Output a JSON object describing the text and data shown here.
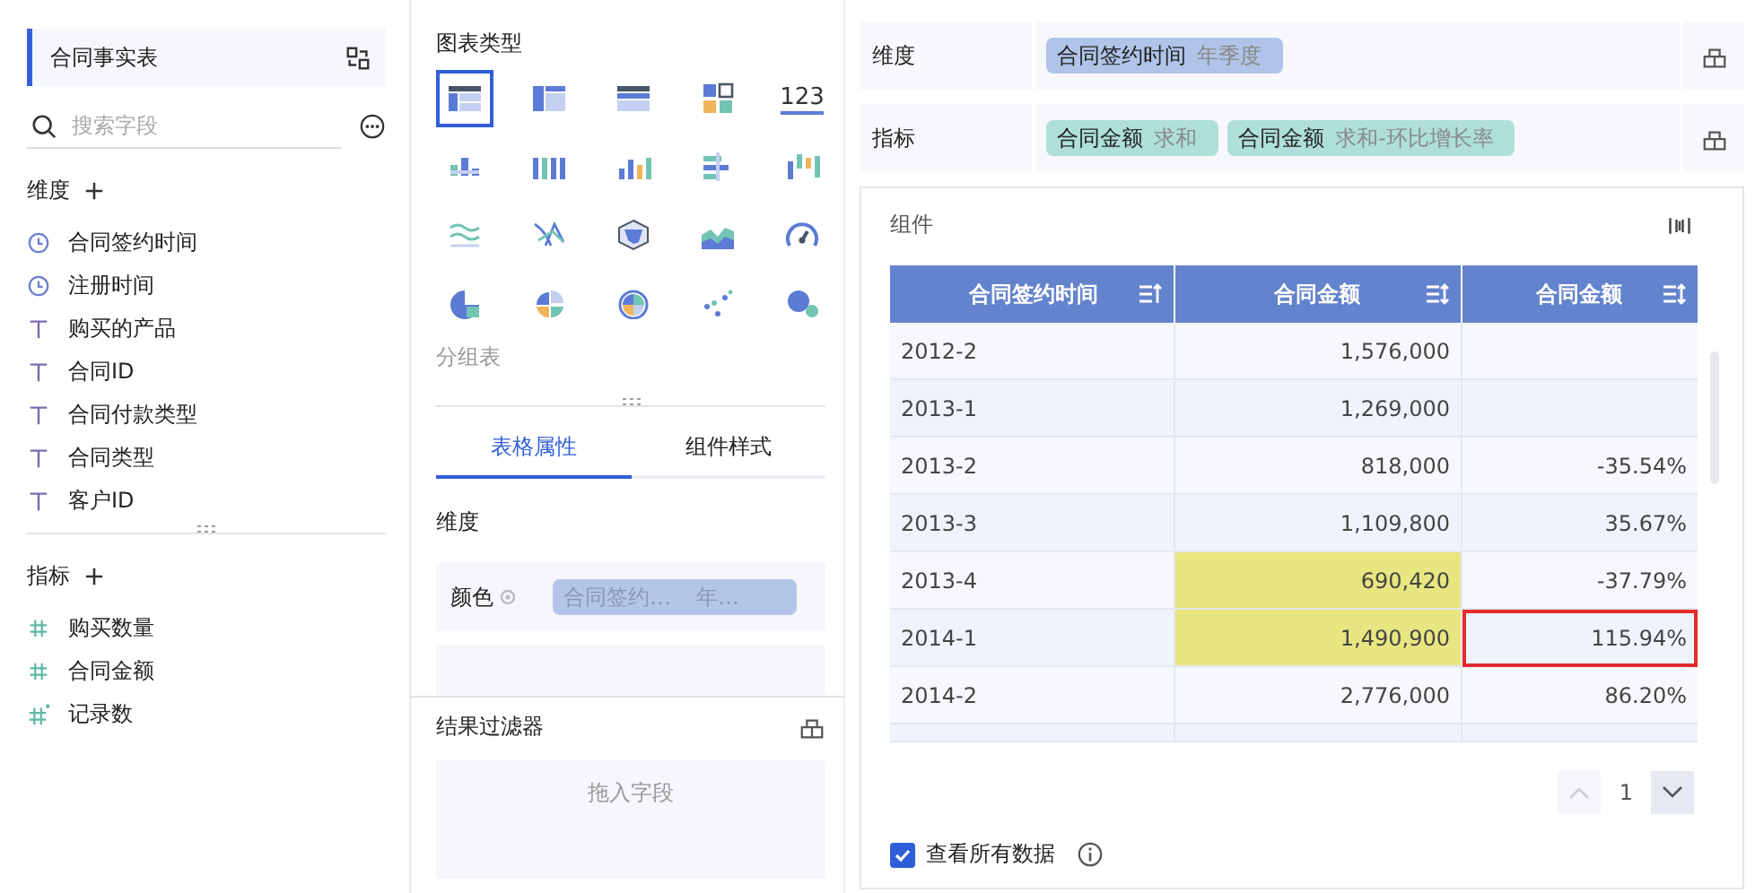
{
  "dataset": {
    "title": "合同事实表"
  },
  "search": {
    "placeholder": "搜索字段"
  },
  "dimensions": {
    "title": "维度",
    "fields": [
      {
        "name": "合同签约时间",
        "kind": "time"
      },
      {
        "name": "注册时间",
        "kind": "time"
      },
      {
        "name": "购买的产品",
        "kind": "text"
      },
      {
        "name": "合同ID",
        "kind": "text"
      },
      {
        "name": "合同付款类型",
        "kind": "text"
      },
      {
        "name": "合同类型",
        "kind": "text"
      },
      {
        "name": "客户ID",
        "kind": "text"
      }
    ]
  },
  "measures": {
    "title": "指标",
    "fields": [
      {
        "name": "购买数量",
        "kind": "number"
      },
      {
        "name": "合同金额",
        "kind": "number"
      },
      {
        "name": "记录数",
        "kind": "count"
      }
    ]
  },
  "chart_types": {
    "title": "图表类型",
    "caption": "分组表",
    "items": [
      {
        "selected": true
      },
      {
        "selected": false
      },
      {
        "selected": false
      },
      {
        "selected": false
      },
      {
        "selected": false,
        "label": "123"
      },
      {
        "selected": false
      },
      {
        "selected": false
      },
      {
        "selected": false
      },
      {
        "selected": false
      },
      {
        "selected": false
      },
      {
        "selected": false
      },
      {
        "selected": false
      },
      {
        "selected": false
      },
      {
        "selected": false
      },
      {
        "selected": false
      },
      {
        "selected": false
      },
      {
        "selected": false
      },
      {
        "selected": false
      },
      {
        "selected": false
      },
      {
        "selected": false
      }
    ]
  },
  "props_tabs": [
    {
      "label": "表格属性",
      "selected": true
    },
    {
      "label": "组件样式",
      "selected": false
    }
  ],
  "props": {
    "section": "维度",
    "rows": [
      {
        "label": "颜色",
        "field": "合同签约…",
        "agg": "年…"
      }
    ]
  },
  "filter": {
    "title": "结果过滤器",
    "placeholder": "拖入字段"
  },
  "shelves": [
    {
      "label": "维度",
      "kind": "dimension",
      "pills": [
        {
          "field": "合同签约时间",
          "agg": "年季度"
        }
      ]
    },
    {
      "label": "指标",
      "kind": "measure",
      "pills": [
        {
          "field": "合同金额",
          "agg": "求和"
        },
        {
          "field": "合同金额",
          "agg": "求和-环比增长率"
        }
      ]
    }
  ],
  "widget": {
    "title": "组件",
    "table": {
      "columns": [
        "合同签约时间",
        "合同金额",
        "合同金额"
      ],
      "rows": [
        {
          "period": "2012-2",
          "amount": "1,576,000",
          "highlighted": false,
          "outlined": false
        },
        {
          "period": "2013-1",
          "amount": "1,269,000",
          "highlighted": false,
          "outlined": false
        },
        {
          "period": "2013-2",
          "amount": "818,000",
          "growth": "-35.54%",
          "highlighted": false,
          "outlined": false
        },
        {
          "period": "2013-3",
          "amount": "1,109,800",
          "growth": "35.67%",
          "highlighted": false,
          "outlined": false
        },
        {
          "period": "2013-4",
          "amount": "690,420",
          "growth": "-37.79%",
          "highlighted": true,
          "outlined": false
        },
        {
          "period": "2014-1",
          "amount": "1,490,900",
          "growth": "115.94%",
          "highlighted": true,
          "outlined": true
        },
        {
          "period": "2014-2",
          "amount": "2,776,000",
          "growth": "86.20%",
          "highlighted": false,
          "outlined": false
        }
      ]
    },
    "page": "1",
    "show_all": {
      "label": "查看所有数据",
      "checked": true
    }
  }
}
